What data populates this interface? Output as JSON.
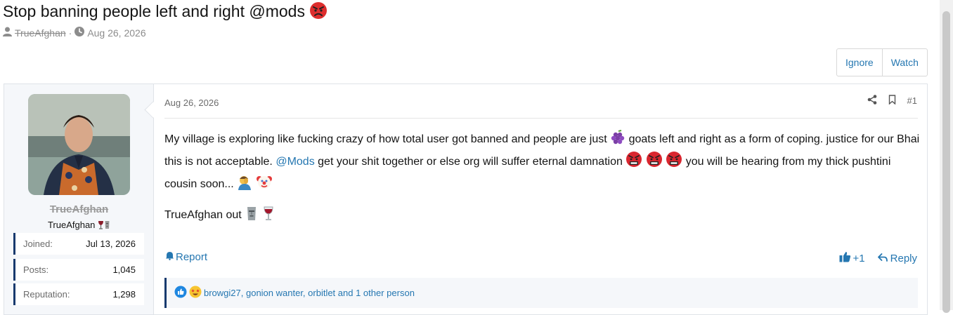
{
  "thread": {
    "title": "Stop banning people left and right @mods",
    "author": "TrueAfghan",
    "separator": "·",
    "date": "Aug 26, 2026"
  },
  "actions": {
    "ignore": "Ignore",
    "watch": "Watch"
  },
  "user": {
    "name": "TrueAfghan",
    "title": "TrueAfghan",
    "stats": [
      {
        "label": "Joined:",
        "value": "Jul 13, 2026"
      },
      {
        "label": "Posts:",
        "value": "1,045"
      },
      {
        "label": "Reputation:",
        "value": "1,298"
      }
    ]
  },
  "post": {
    "date": "Aug 26, 2026",
    "number": "#1",
    "text_1": "My village is exploring like fucking crazy of how total user got banned and people are just",
    "text_2": "goats left and right as a form of coping. justice for our Bhai this is not acceptable.",
    "mention": "@Mods",
    "text_3": "get your shit together or else org will suffer eternal damnation",
    "text_4": "you will be hearing from my thick pushtini cousin soon...",
    "text_5": "TrueAfghan out",
    "report": "Report",
    "like_count": "+1",
    "reply": "Reply",
    "reactors": "browgi27, gonion wanter, orbitlet and 1 other person"
  },
  "colors": {
    "link": "#2577b1",
    "stat_accent": "#183a6e"
  }
}
